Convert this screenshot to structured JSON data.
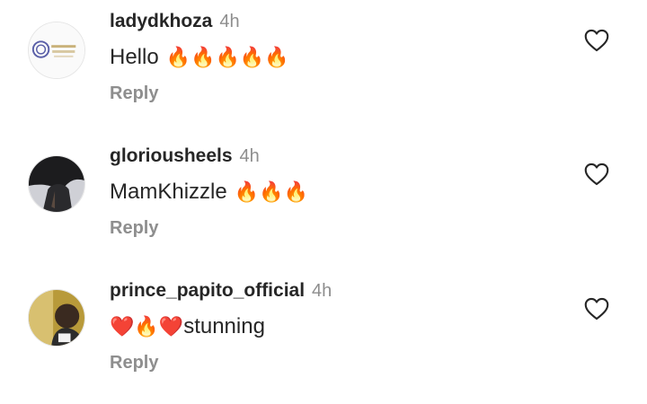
{
  "comments": [
    {
      "username": "ladydkhoza",
      "time": "4h",
      "text": "Hello",
      "emojis": "🔥🔥🔥🔥🔥",
      "reply_label": "Reply",
      "avatar_icon": "profile-logo",
      "like_icon": "heart-outline-icon"
    },
    {
      "username": "gloriousheels",
      "time": "4h",
      "text": "MamKhizzle",
      "emojis": "🔥🔥🔥",
      "reply_label": "Reply",
      "avatar_icon": "profile-photo",
      "like_icon": "heart-outline-icon"
    },
    {
      "username": "prince_papito_official",
      "time": "4h",
      "text": "stunning",
      "emojis": "❤️🔥❤️",
      "reply_label": "Reply",
      "avatar_icon": "profile-photo",
      "like_icon": "heart-outline-icon"
    }
  ],
  "colors": {
    "text": "#262626",
    "muted": "#8e8e8e",
    "background": "#ffffff"
  }
}
